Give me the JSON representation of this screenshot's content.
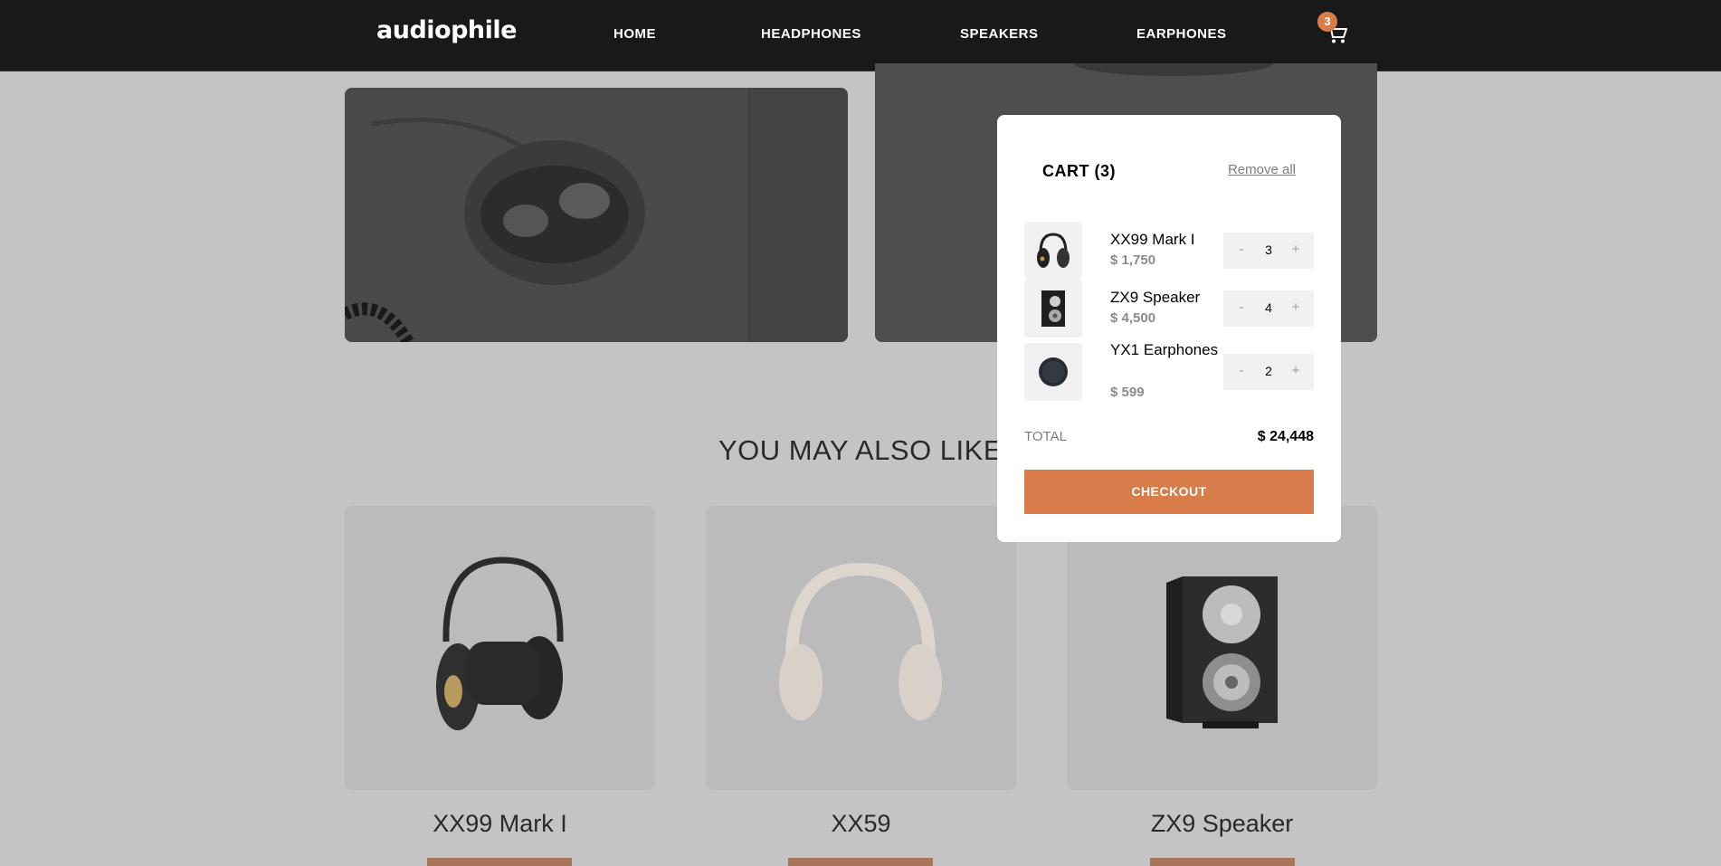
{
  "header": {
    "logo": "audiophile",
    "nav": [
      {
        "label": "HOME"
      },
      {
        "label": "HEADPHONES"
      },
      {
        "label": "SPEAKERS"
      },
      {
        "label": "EARPHONES"
      }
    ],
    "cart_count": "3",
    "cart_icon": "cart-icon"
  },
  "section": {
    "title": "YOU MAY ALSO LIKE"
  },
  "products": [
    {
      "name": "XX99 Mark I"
    },
    {
      "name": "XX59"
    },
    {
      "name": "ZX9 Speaker"
    }
  ],
  "cart": {
    "title": "CART (3)",
    "remove_all": "Remove all",
    "items": [
      {
        "name": "XX99 Mark I",
        "price": "$ 1,750",
        "qty": "3"
      },
      {
        "name": "ZX9 Speaker",
        "price": "$ 4,500",
        "qty": "4"
      },
      {
        "name": "YX1 Earphones",
        "price": "$ 599",
        "qty": "2"
      }
    ],
    "minus": "-",
    "plus": "+",
    "total_label": "TOTAL",
    "total_value": "$ 24,448",
    "checkout": "CHECKOUT"
  },
  "colors": {
    "accent": "#d87d4a",
    "header_bg": "#191919",
    "overlay_bg": "#c4c4c4"
  }
}
